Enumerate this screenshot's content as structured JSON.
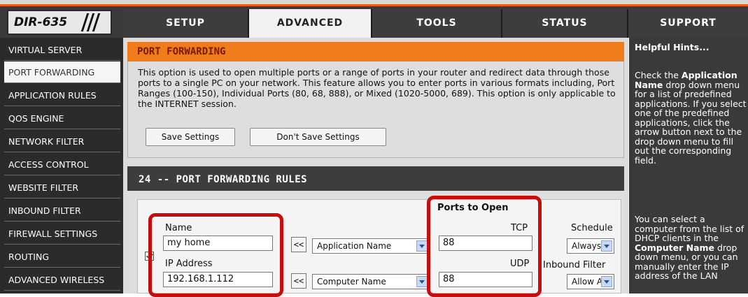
{
  "device": {
    "model": "DIR-635"
  },
  "nav": {
    "tabs": [
      {
        "label": "SETUP"
      },
      {
        "label": "ADVANCED"
      },
      {
        "label": "TOOLS"
      },
      {
        "label": "STATUS"
      },
      {
        "label": "SUPPORT"
      }
    ],
    "active": "ADVANCED"
  },
  "sidebar": {
    "items": [
      {
        "label": "VIRTUAL SERVER"
      },
      {
        "label": "PORT FORWARDING"
      },
      {
        "label": "APPLICATION RULES"
      },
      {
        "label": "QOS ENGINE"
      },
      {
        "label": "NETWORK FILTER"
      },
      {
        "label": "ACCESS CONTROL"
      },
      {
        "label": "WEBSITE FILTER"
      },
      {
        "label": "INBOUND FILTER"
      },
      {
        "label": "FIREWALL SETTINGS"
      },
      {
        "label": "ROUTING"
      },
      {
        "label": "ADVANCED WIRELESS"
      }
    ],
    "active": "PORT FORWARDING"
  },
  "port_forwarding": {
    "title": "PORT FORWARDING",
    "description": "This option is used to open multiple ports or a range of ports in your router and redirect data through those ports to a single PC on your network. This feature allows you to enter ports in various formats including, Port Ranges (100-150), Individual Ports (80, 68, 888), or Mixed (1020-5000, 689). This option is only applicable to the INTERNET session.",
    "save_label": "Save Settings",
    "dont_save_label": "Don't Save Settings"
  },
  "rules": {
    "title": "24 -- PORT FORWARDING RULES",
    "ports_to_open_label": "Ports to Open",
    "row": {
      "checked": true,
      "name_label": "Name",
      "name_value": "my home",
      "ip_label": "IP Address",
      "ip_value": "192.168.1.112",
      "copy_button": "<<",
      "application_select": "Application Name",
      "computer_select": "Computer Name",
      "tcp_label": "TCP",
      "tcp_value": "88",
      "udp_label": "UDP",
      "udp_value": "88",
      "schedule_label": "Schedule",
      "schedule_value": "Always",
      "inbound_label": "Inbound Filter",
      "inbound_value": "Allow All"
    }
  },
  "hints": {
    "title": "Helpful Hints...",
    "p1_a": "Check the ",
    "p1_b": "Application Name",
    "p1_c": " drop down menu for a list of predefined applications. If you select one of the predefined applications, click the arrow button next to the drop down menu to fill out the corresponding field.",
    "p2_a": "You can select a computer from the list of DHCP clients in the ",
    "p2_b": "Computer Name",
    "p2_c": " drop down menu, or you can manually enter the IP address of the LAN"
  },
  "colors": {
    "accent_orange": "#f07b1b",
    "dark_panel": "#3d3d3d",
    "highlight_red": "#c40e0e"
  }
}
